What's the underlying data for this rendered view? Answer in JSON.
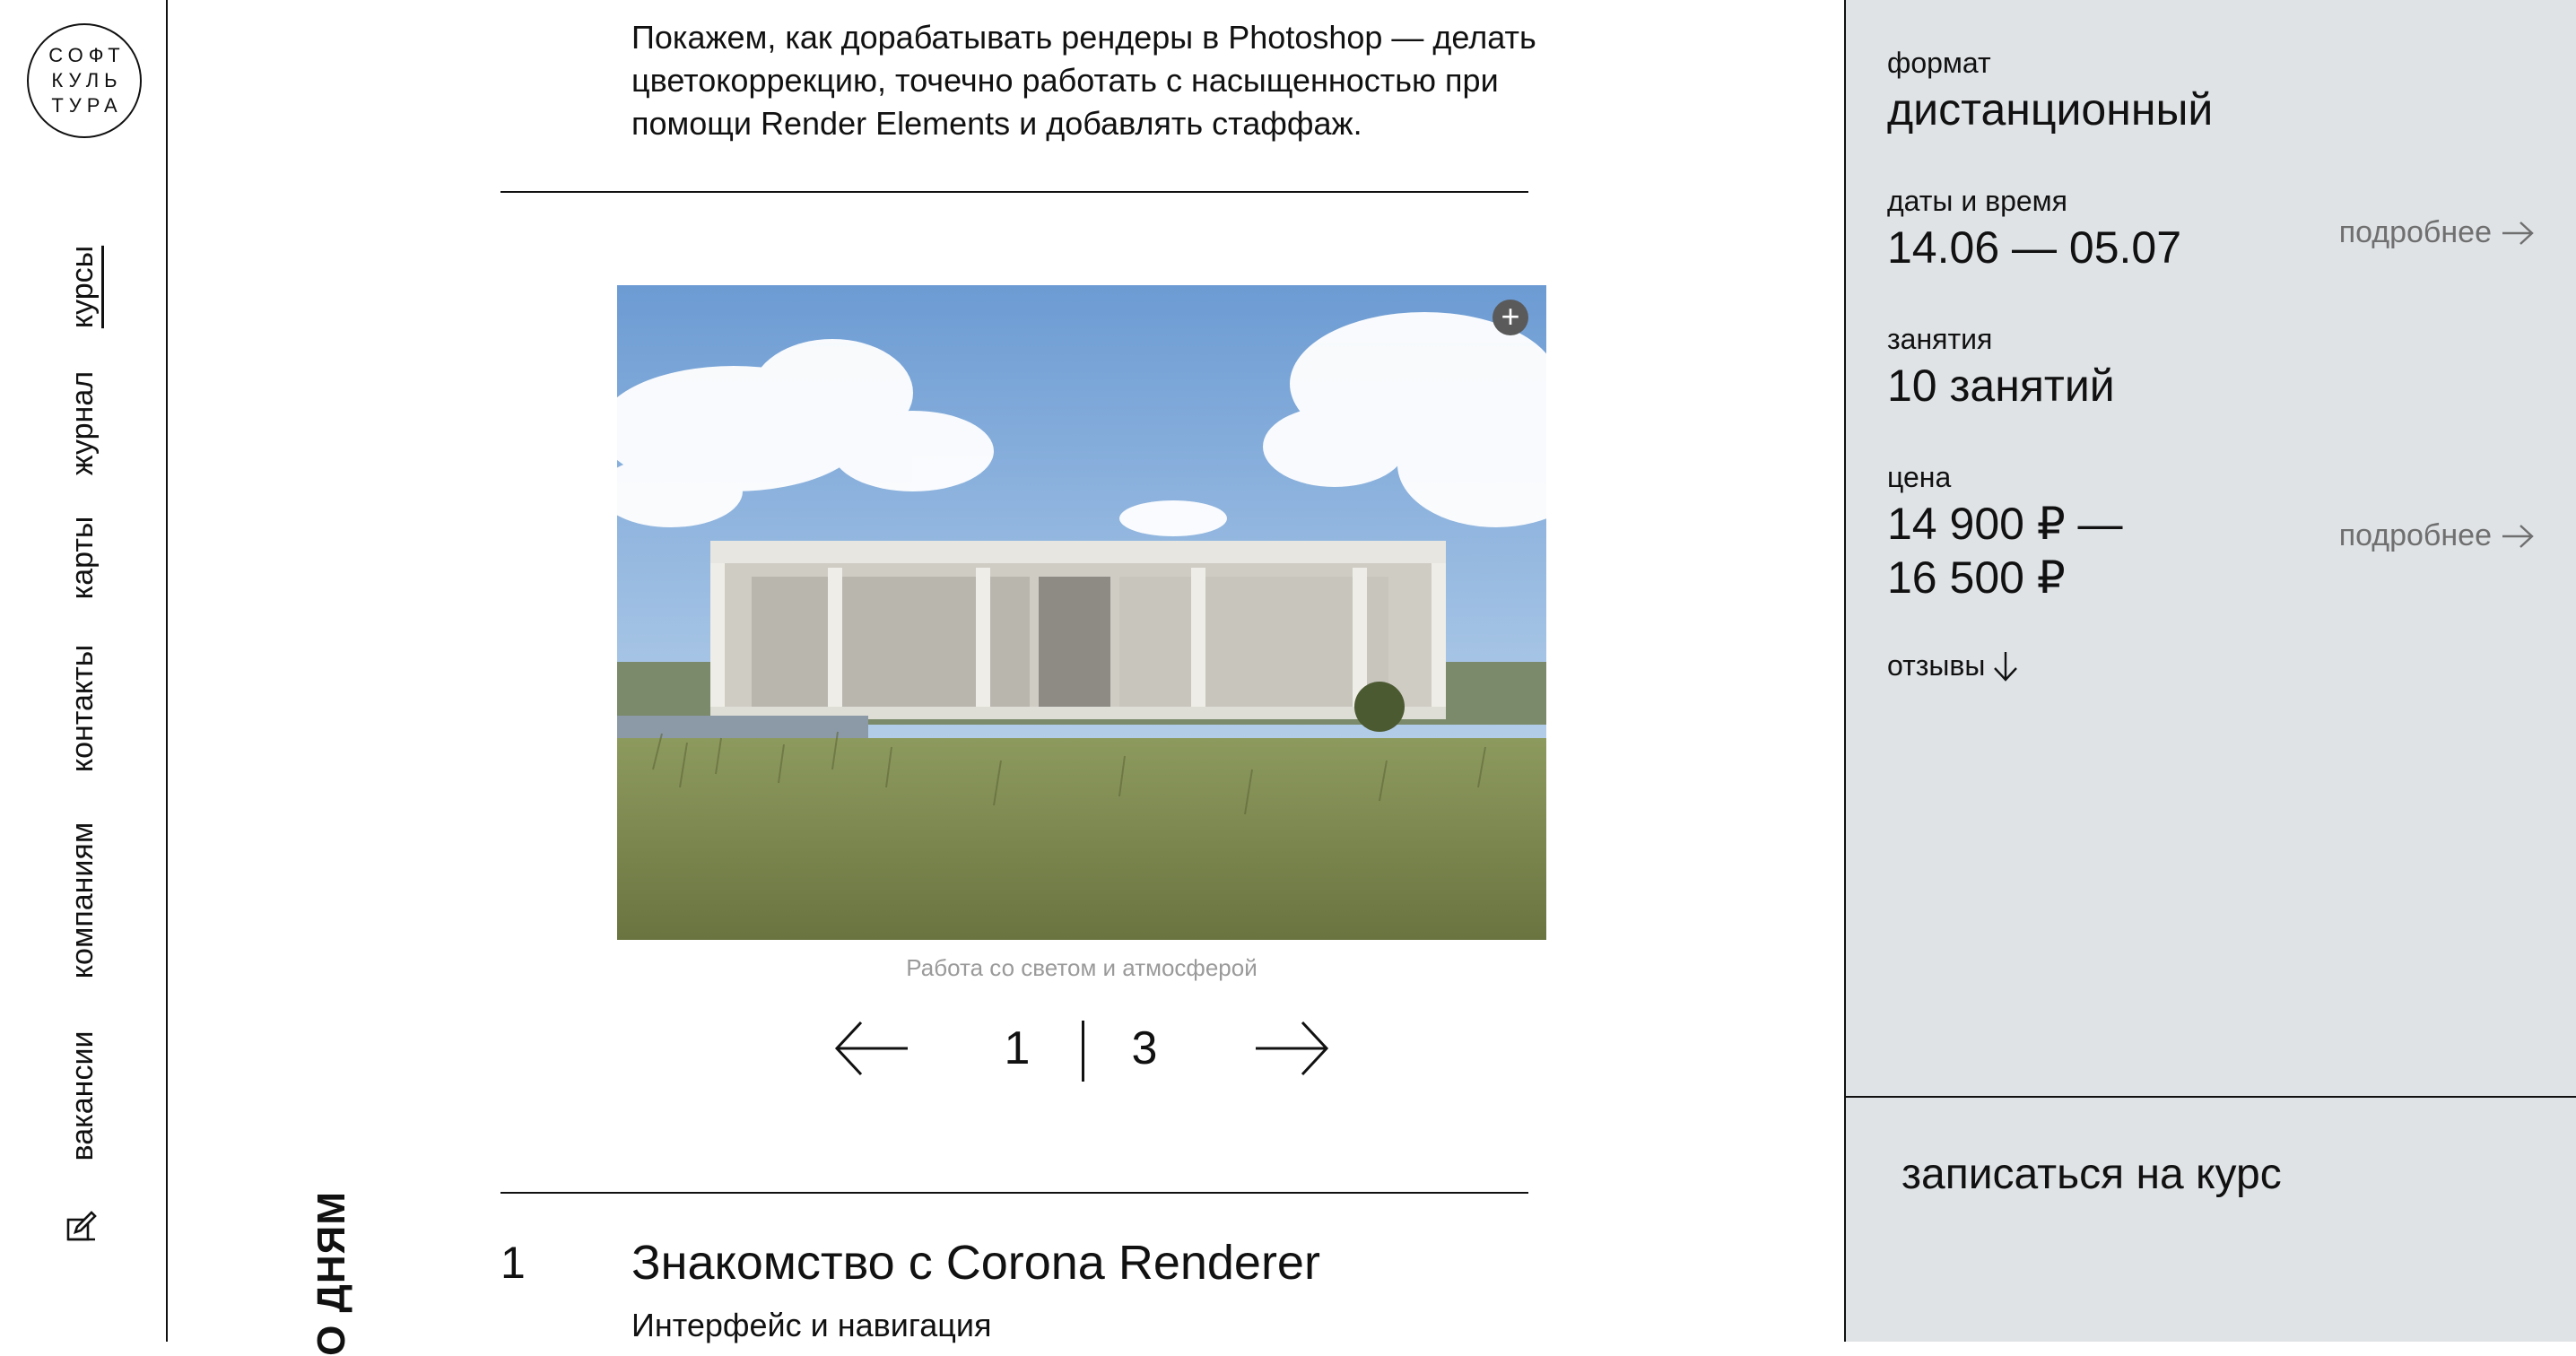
{
  "logo": {
    "lines": [
      "СОФТ",
      "КУЛЬ",
      "ТУРА"
    ]
  },
  "nav": {
    "items": [
      {
        "label": "курсы",
        "active": true
      },
      {
        "label": "журнал"
      },
      {
        "label": "карты"
      },
      {
        "label": "контакты"
      },
      {
        "label": "компаниям"
      },
      {
        "label": "вакансии"
      }
    ],
    "edit_icon": "edit-icon"
  },
  "section_label": "О ДНЯМ",
  "intro": {
    "text": "Покажем, как дорабатывать рендеры в Photoshop — делать цветокоррекцию, точечно работать с насыщенностью при помощи Render Elements и добавлять стаффаж."
  },
  "gallery": {
    "caption": "Работа со светом и атмосферой",
    "current": "1",
    "total": "3",
    "zoom_icon": "plus-icon",
    "prev_icon": "arrow-left-icon",
    "next_icon": "arrow-right-icon"
  },
  "program": {
    "day_number": "1",
    "day_title": "Знакомство с Corona Renderer",
    "day_subtitle": "Интерфейс и навигация"
  },
  "panel": {
    "format_label": "формат",
    "format_value": "дистанционный",
    "dates_label": "даты и время",
    "dates_value": "14.06 — 05.07",
    "dates_more": "подробнее",
    "lessons_label": "занятия",
    "lessons_value": "10 занятий",
    "price_label": "цена",
    "price_line1": "14 900 ₽ —",
    "price_line2": "16 500 ₽",
    "price_more": "подробнее",
    "reviews": "отзывы",
    "enroll": "записаться на курс"
  },
  "colors": {
    "panel_bg": "#dfe3e6",
    "text": "#111111",
    "muted": "#6f6f6f",
    "caption": "#9a9a9a"
  }
}
